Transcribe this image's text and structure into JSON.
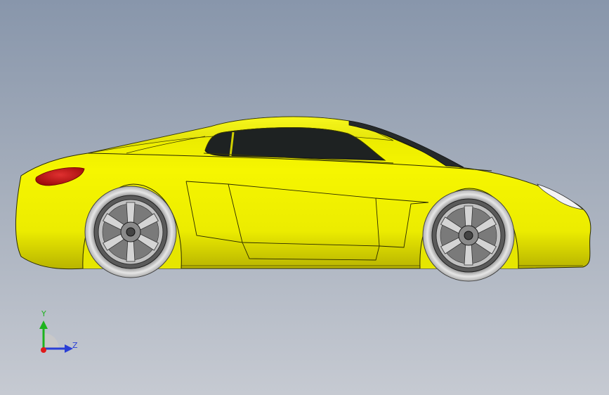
{
  "viewport": {
    "background_top": "#8896ab",
    "background_bottom": "#c6cad2"
  },
  "model": {
    "icon": "car-3d-model",
    "body_color": "#f2f200",
    "glass_color": "#1e2222",
    "taillight_color": "#c81616",
    "tire_color": "#d8d8d8"
  },
  "triad": {
    "y_label": "Y",
    "z_label": "Z",
    "y_color": "#1db31d",
    "z_color": "#2a3fd6",
    "x_color": "#e01a1a"
  }
}
